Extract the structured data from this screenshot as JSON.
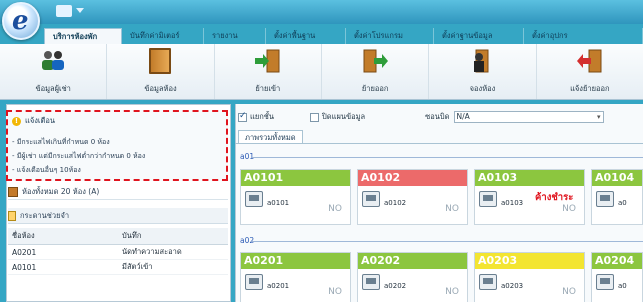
{
  "tabs": [
    "บริการห้องพัก",
    "บันทึกค่ามิเตอร์",
    "รายงาน",
    "ตั้งค่าพื้นฐาน",
    "ตั้งค่าโปรแกรม",
    "ตั้งค่าฐานข้อมูล",
    "ตั้งค่าอุปกร"
  ],
  "ribbon": [
    {
      "label": "ข้อมูลผู้เช่า",
      "icon": "users-icon"
    },
    {
      "label": "ข้อมูลห้อง",
      "icon": "door-icon"
    },
    {
      "label": "ย้ายเข้า",
      "icon": "move-in-icon"
    },
    {
      "label": "ย้ายออก",
      "icon": "move-out-icon"
    },
    {
      "label": "จองห้อง",
      "icon": "booking-icon"
    },
    {
      "label": "แจ้งย้ายออก",
      "icon": "notify-move-out-icon"
    }
  ],
  "notice": {
    "title": "แจ้งเตือน",
    "lines": [
      "- มีกระแสไฟเกินที่กำหนด 0 ห้อง",
      "- มีผู้เช่า แต่มีกระแสไฟต่ำกว่ากำหนด 0 ห้อง",
      "- แจ้งเตือนอื่นๆ 10ห้อง"
    ]
  },
  "room_count": "ห้องทั้งหมด 20 ห้อง (A)",
  "board": {
    "title": "กระดานช่วยจำ",
    "headers": [
      "ชื่อห้อง",
      "บันทึก"
    ],
    "rows": [
      [
        "A0201",
        "นัดทำความสะอาด"
      ],
      [
        "A0101",
        "มีสัตว์เข้า"
      ]
    ]
  },
  "filters": {
    "cb1": "แยกชั้น",
    "cb2": "ปิดแผนข้อมูล",
    "zone_label": "ซอนบิด",
    "zone_value": "N/A"
  },
  "subtab": "ภาพรวมทั้งหมด",
  "floors": [
    {
      "label": "a01",
      "rooms": [
        {
          "name": "A0101",
          "code": "a0101",
          "status": "NO",
          "color": "#8cc63f",
          "note": ""
        },
        {
          "name": "A0102",
          "code": "a0102",
          "status": "NO",
          "color": "#ec6a6a",
          "note": ""
        },
        {
          "name": "A0103",
          "code": "a0103",
          "status": "NO",
          "color": "#8cc63f",
          "note": "ค้างชำระ"
        },
        {
          "name": "A0104",
          "code": "a0",
          "status": "",
          "color": "#8cc63f",
          "note": ""
        }
      ]
    },
    {
      "label": "a02",
      "rooms": [
        {
          "name": "A0201",
          "code": "a0201",
          "status": "NO",
          "color": "#8cc63f",
          "note": ""
        },
        {
          "name": "A0202",
          "code": "a0202",
          "status": "NO",
          "color": "#8cc63f",
          "note": ""
        },
        {
          "name": "A0203",
          "code": "a0203",
          "status": "NO",
          "color": "#f3e531",
          "note": ""
        },
        {
          "name": "A0204",
          "code": "a0",
          "status": "",
          "color": "#8cc63f",
          "note": ""
        }
      ]
    }
  ]
}
